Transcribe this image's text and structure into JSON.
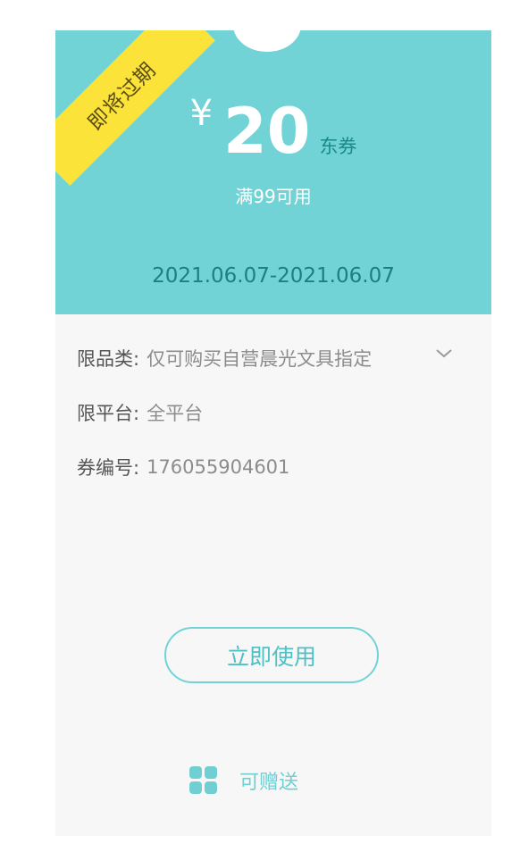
{
  "coupon": {
    "ribbon_label": "即将过期",
    "currency_symbol": "¥",
    "amount": "20",
    "unit": "东券",
    "condition": "满99可用",
    "validity": "2021.06.07-2021.06.07"
  },
  "details": {
    "category_label": "限品类:",
    "category_value": "仅可购买自营晨光文具指定",
    "platform_label": "限平台:",
    "platform_value": "全平台",
    "number_label": "券编号:",
    "number_value": "176055904601"
  },
  "actions": {
    "use_label": "立即使用",
    "gift_label": "可赠送",
    "gift_icon": "grid-icon"
  },
  "colors": {
    "accent": "#72d3d6",
    "ribbon": "#fce33a",
    "card_bg": "#f7f7f7"
  }
}
